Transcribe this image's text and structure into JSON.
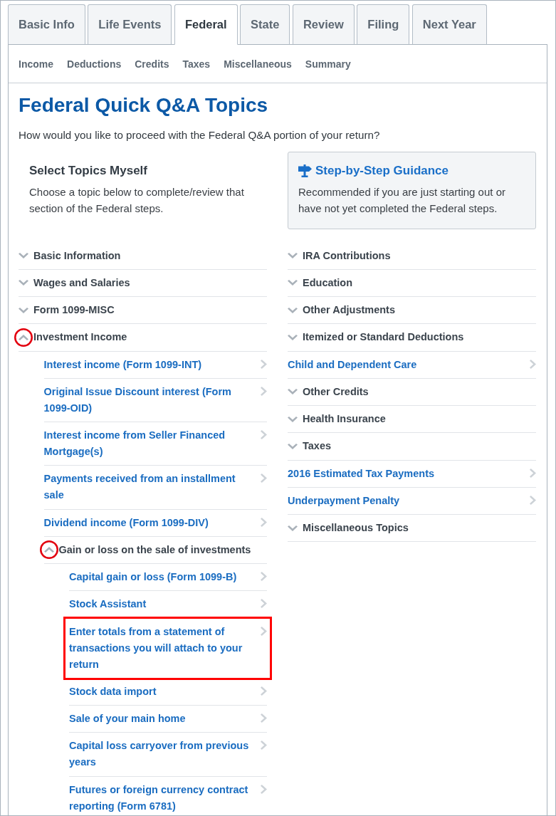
{
  "tabs": [
    {
      "label": "Basic Info",
      "selected": false
    },
    {
      "label": "Life Events",
      "selected": false
    },
    {
      "label": "Federal",
      "selected": true
    },
    {
      "label": "State",
      "selected": false
    },
    {
      "label": "Review",
      "selected": false
    },
    {
      "label": "Filing",
      "selected": false
    },
    {
      "label": "Next Year",
      "selected": false
    }
  ],
  "subnav": [
    "Income",
    "Deductions",
    "Credits",
    "Taxes",
    "Miscellaneous",
    "Summary"
  ],
  "title": "Federal Quick Q&A Topics",
  "intro": "How would you like to proceed with the Federal Q&A portion of your return?",
  "columns": [
    {
      "option": {
        "kind": "plain",
        "heading": "Select Topics Myself",
        "description": "Choose a topic below to complete/review that section of the Federal steps."
      },
      "topics": [
        {
          "kind": "group",
          "label": "Basic Information",
          "expanded": false,
          "highlighted": false
        },
        {
          "kind": "group",
          "label": "Wages and Salaries",
          "expanded": false,
          "highlighted": false
        },
        {
          "kind": "group",
          "label": "Form 1099-MISC",
          "expanded": false,
          "highlighted": false
        },
        {
          "kind": "group",
          "label": "Investment Income",
          "expanded": true,
          "highlighted": true,
          "children": [
            {
              "kind": "link",
              "label": "Interest income (Form 1099-INT)",
              "highlighted": false
            },
            {
              "kind": "link",
              "label": "Original Issue Discount interest (Form 1099-OID)",
              "highlighted": false
            },
            {
              "kind": "link",
              "label": "Interest income from Seller Financed Mortgage(s)",
              "highlighted": false
            },
            {
              "kind": "link",
              "label": "Payments received from an installment sale",
              "highlighted": false
            },
            {
              "kind": "link",
              "label": "Dividend income (Form 1099-DIV)",
              "highlighted": false
            },
            {
              "kind": "group",
              "label": "Gain or loss on the sale of investments",
              "expanded": true,
              "highlighted": true,
              "children": [
                {
                  "kind": "link",
                  "label": "Capital gain or loss (Form 1099-B)",
                  "highlighted": false
                },
                {
                  "kind": "link",
                  "label": "Stock Assistant",
                  "highlighted": false
                },
                {
                  "kind": "link",
                  "label": "Enter totals from a statement of transactions you will attach to your return",
                  "highlighted": true
                },
                {
                  "kind": "link",
                  "label": "Stock data import",
                  "highlighted": false
                },
                {
                  "kind": "link",
                  "label": "Sale of your main home",
                  "highlighted": false
                },
                {
                  "kind": "link",
                  "label": "Capital loss carryover from previous years",
                  "highlighted": false
                },
                {
                  "kind": "link",
                  "label": "Futures or foreign currency contract reporting (Form 6781)",
                  "highlighted": false
                }
              ]
            }
          ]
        }
      ]
    },
    {
      "option": {
        "kind": "card",
        "heading": "Step-by-Step Guidance",
        "description": "Recommended if you are just starting out or have not yet completed the Federal steps."
      },
      "topics": [
        {
          "kind": "group",
          "label": "IRA Contributions",
          "expanded": false,
          "highlighted": false
        },
        {
          "kind": "group",
          "label": "Education",
          "expanded": false,
          "highlighted": false
        },
        {
          "kind": "group",
          "label": "Other Adjustments",
          "expanded": false,
          "highlighted": false
        },
        {
          "kind": "group",
          "label": "Itemized or Standard Deductions",
          "expanded": false,
          "highlighted": false
        },
        {
          "kind": "link",
          "label": "Child and Dependent Care",
          "highlighted": false
        },
        {
          "kind": "group",
          "label": "Other Credits",
          "expanded": false,
          "highlighted": false
        },
        {
          "kind": "group",
          "label": "Health Insurance",
          "expanded": false,
          "highlighted": false
        },
        {
          "kind": "group",
          "label": "Taxes",
          "expanded": false,
          "highlighted": false
        },
        {
          "kind": "link",
          "label": "2016 Estimated Tax Payments",
          "highlighted": false
        },
        {
          "kind": "link",
          "label": "Underpayment Penalty",
          "highlighted": false
        },
        {
          "kind": "group",
          "label": "Miscellaneous Topics",
          "expanded": false,
          "highlighted": false
        }
      ]
    }
  ]
}
